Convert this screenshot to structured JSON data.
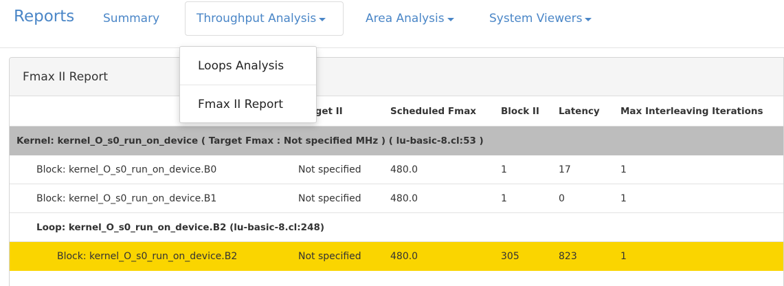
{
  "nav": {
    "brand": "Reports",
    "summary": "Summary",
    "throughput": "Throughput Analysis",
    "area": "Area Analysis",
    "system": "System Viewers"
  },
  "dropdown": {
    "items": [
      "Loops Analysis",
      "Fmax II Report"
    ]
  },
  "panel": {
    "title": "Fmax II Report"
  },
  "table": {
    "headers": {
      "target_ii_partial": "rget II",
      "scheduled_fmax": "Scheduled Fmax",
      "block_ii": "Block II",
      "latency": "Latency",
      "max_interleaving": "Max Interleaving Iterations"
    },
    "kernel_row": "Kernel: kernel_O_s0_run_on_device ( Target Fmax : Not specified MHz ) ( lu-basic-8.cl:53 )",
    "rows": [
      {
        "name": "Block: kernel_O_s0_run_on_device.B0",
        "target_ii": "Not specified",
        "fmax": "480.0",
        "block_ii": "1",
        "latency": "17",
        "max_int": "1"
      },
      {
        "name": "Block: kernel_O_s0_run_on_device.B1",
        "target_ii": "Not specified",
        "fmax": "480.0",
        "block_ii": "1",
        "latency": "0",
        "max_int": "1"
      }
    ],
    "loop_row": "Loop: kernel_O_s0_run_on_device.B2 (lu-basic-8.cl:248)",
    "highlight_row": {
      "name": "Block: kernel_O_s0_run_on_device.B2",
      "target_ii": "Not specified",
      "fmax": "480.0",
      "block_ii": "305",
      "latency": "823",
      "max_int": "1"
    }
  },
  "colors": {
    "nav_link": "#4a86c7",
    "kernel_row_bg": "#bdbdbd",
    "highlight_bg": "#fad500"
  }
}
